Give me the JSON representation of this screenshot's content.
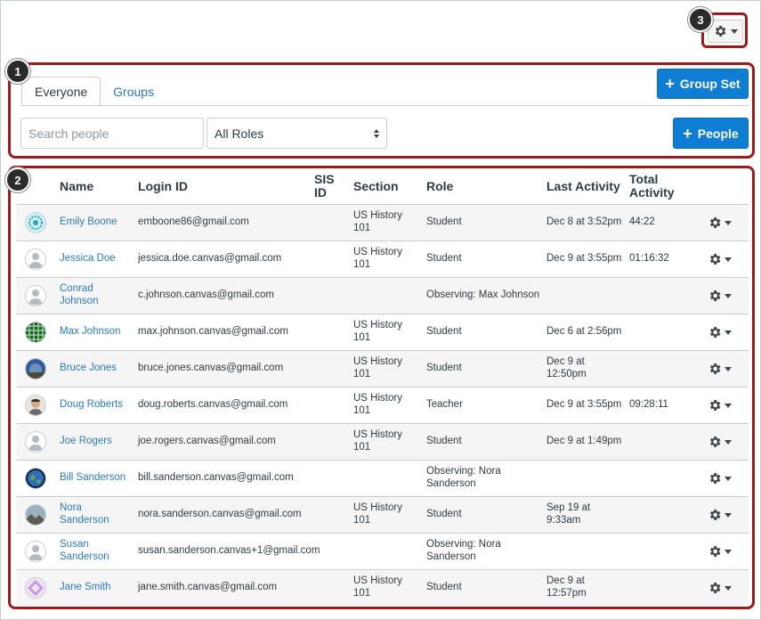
{
  "callouts": {
    "one": "1",
    "two": "2",
    "three": "3"
  },
  "settings": {
    "icon": "gear-icon"
  },
  "tabs": [
    {
      "label": "Everyone",
      "active": true
    },
    {
      "label": "Groups",
      "active": false
    }
  ],
  "buttons": {
    "group_set": "Group Set",
    "people": "People"
  },
  "search": {
    "placeholder": "Search people",
    "value": ""
  },
  "roles_select": {
    "selected": "All Roles"
  },
  "table": {
    "headers": {
      "name": "Name",
      "login": "Login ID",
      "sis_line1": "SIS",
      "sis_line2": "ID",
      "section": "Section",
      "role": "Role",
      "last_activity": "Last Activity",
      "total_line1": "Total",
      "total_line2": "Activity"
    },
    "rows": [
      {
        "name1": "Emily Boone",
        "name2": "",
        "login": "emboone86@gmail.com",
        "section1": "US History",
        "section2": "101",
        "role1": "Student",
        "role2": "",
        "activity1": "Dec 8 at 3:52pm",
        "activity2": "",
        "total": "44:22",
        "avatar": "pattern-teal"
      },
      {
        "name1": "Jessica Doe",
        "name2": "",
        "login": "jessica.doe.canvas@gmail.com",
        "section1": "US History",
        "section2": "101",
        "role1": "Student",
        "role2": "",
        "activity1": "Dec 9 at 3:55pm",
        "activity2": "",
        "total": "01:16:32",
        "avatar": "default"
      },
      {
        "name1": "Conrad",
        "name2": "Johnson",
        "login": "c.johnson.canvas@gmail.com",
        "section1": "",
        "section2": "",
        "role1": "Observing: Max Johnson",
        "role2": "",
        "activity1": "",
        "activity2": "",
        "total": "",
        "avatar": "default"
      },
      {
        "name1": "Max Johnson",
        "name2": "",
        "login": "max.johnson.canvas@gmail.com",
        "section1": "US History",
        "section2": "101",
        "role1": "Student",
        "role2": "",
        "activity1": "Dec 6 at 2:56pm",
        "activity2": "",
        "total": "",
        "avatar": "pattern-green"
      },
      {
        "name1": "Bruce Jones",
        "name2": "",
        "login": "bruce.jones.canvas@gmail.com",
        "section1": "US History",
        "section2": "101",
        "role1": "Student",
        "role2": "",
        "activity1": "Dec 9 at",
        "activity2": "12:50pm",
        "total": "",
        "avatar": "photo-blue"
      },
      {
        "name1": "Doug Roberts",
        "name2": "",
        "login": "doug.roberts.canvas@gmail.com",
        "section1": "US History",
        "section2": "101",
        "role1": "Teacher",
        "role2": "",
        "activity1": "Dec 9 at 3:55pm",
        "activity2": "",
        "total": "09:28:11",
        "avatar": "photo-face"
      },
      {
        "name1": "Joe Rogers",
        "name2": "",
        "login": "joe.rogers.canvas@gmail.com",
        "section1": "US History",
        "section2": "101",
        "role1": "Student",
        "role2": "",
        "activity1": "Dec 9 at 1:49pm",
        "activity2": "",
        "total": "",
        "avatar": "default"
      },
      {
        "name1": "Bill Sanderson",
        "name2": "",
        "login": "bill.sanderson.canvas@gmail.com",
        "section1": "",
        "section2": "",
        "role1": "Observing: Nora",
        "role2": "Sanderson",
        "activity1": "",
        "activity2": "",
        "total": "",
        "avatar": "photo-earth"
      },
      {
        "name1": "Nora",
        "name2": "Sanderson",
        "login": "nora.sanderson.canvas@gmail.com",
        "section1": "US History",
        "section2": "101",
        "role1": "Student",
        "role2": "",
        "activity1": "Sep 19 at",
        "activity2": "9:33am",
        "total": "",
        "avatar": "photo-landscape"
      },
      {
        "name1": "Susan",
        "name2": "Sanderson",
        "login": "susan.sanderson.canvas+1@gmail.com",
        "section1": "",
        "section2": "",
        "role1": "Observing: Nora",
        "role2": "Sanderson",
        "activity1": "",
        "activity2": "",
        "total": "",
        "avatar": "default"
      },
      {
        "name1": "Jane Smith",
        "name2": "",
        "login": "jane.smith.canvas@gmail.com",
        "section1": "US History",
        "section2": "101",
        "role1": "Student",
        "role2": "",
        "activity1": "Dec 9 at",
        "activity2": "12:57pm",
        "total": "",
        "avatar": "pattern-purple"
      }
    ]
  },
  "colors": {
    "link": "#2a7abc",
    "primary": "#0e7dd3",
    "callout_border": "#9b1c1c",
    "text": "#2d3b45"
  }
}
